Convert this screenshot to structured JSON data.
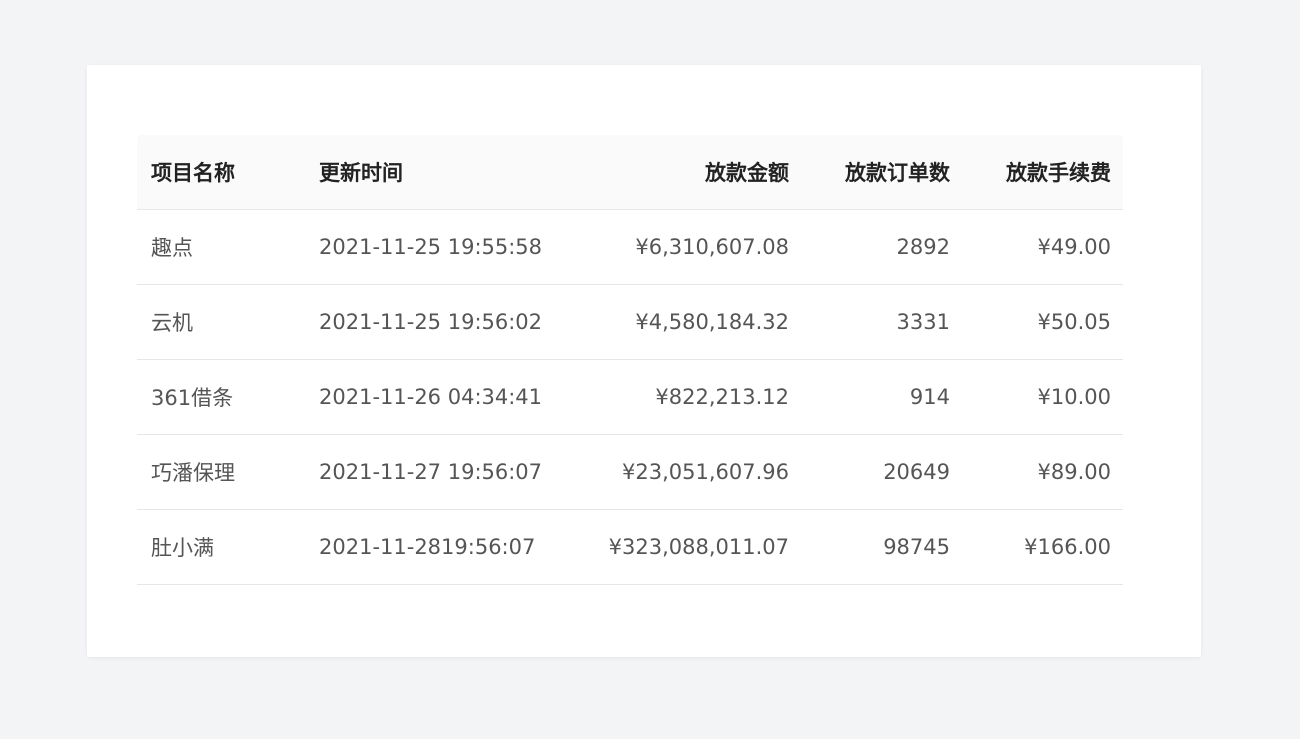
{
  "table": {
    "columns": [
      "项目名称",
      "更新时间",
      "放款金额",
      "放款订单数",
      "放款手续费"
    ],
    "rows": [
      {
        "name": "趣点",
        "time": "2021-11-25 19:55:58",
        "amount": "¥6,310,607.08",
        "orders": "2892",
        "fee": "¥49.00"
      },
      {
        "name": "云机",
        "time": "2021-11-25 19:56:02",
        "amount": "¥4,580,184.32",
        "orders": "3331",
        "fee": "¥50.05"
      },
      {
        "name": "361借条",
        "time": "2021-11-26 04:34:41",
        "amount": "¥822,213.12",
        "orders": "914",
        "fee": "¥10.00"
      },
      {
        "name": "巧潘保理",
        "time": "2021-11-27 19:56:07",
        "amount": "¥23,051,607.96",
        "orders": "20649",
        "fee": "¥89.00"
      },
      {
        "name": "肚小满",
        "time": "2021-11-2819:56:07",
        "amount": "¥323,088,011.07",
        "orders": "98745",
        "fee": "¥166.00"
      }
    ]
  }
}
